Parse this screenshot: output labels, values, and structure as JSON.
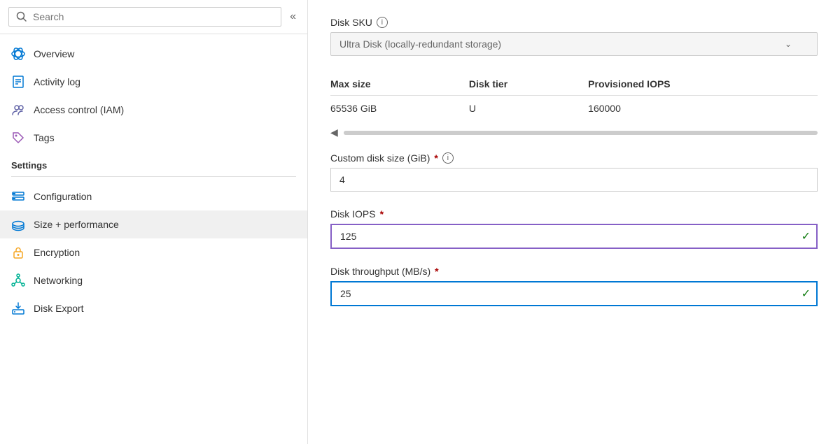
{
  "sidebar": {
    "search": {
      "placeholder": "Search",
      "value": ""
    },
    "collapse_label": "«",
    "nav_items": [
      {
        "id": "overview",
        "label": "Overview",
        "icon": "overview",
        "active": false
      },
      {
        "id": "activity-log",
        "label": "Activity log",
        "icon": "activity",
        "active": false
      },
      {
        "id": "access-control",
        "label": "Access control (IAM)",
        "icon": "access",
        "active": false
      },
      {
        "id": "tags",
        "label": "Tags",
        "icon": "tags",
        "active": false
      }
    ],
    "settings_section": {
      "label": "Settings",
      "items": [
        {
          "id": "configuration",
          "label": "Configuration",
          "icon": "config",
          "active": false
        },
        {
          "id": "size-performance",
          "label": "Size + performance",
          "icon": "size",
          "active": true
        },
        {
          "id": "encryption",
          "label": "Encryption",
          "icon": "encryption",
          "active": false
        },
        {
          "id": "networking",
          "label": "Networking",
          "icon": "networking",
          "active": false
        },
        {
          "id": "disk-export",
          "label": "Disk Export",
          "icon": "export",
          "active": false
        }
      ]
    }
  },
  "main": {
    "disk_sku": {
      "label": "Disk SKU",
      "value": "Ultra Disk (locally-redundant storage)"
    },
    "table": {
      "columns": [
        "Max size",
        "Disk tier",
        "Provisioned IOPS"
      ],
      "rows": [
        {
          "max_size": "65536 GiB",
          "disk_tier": "U",
          "provisioned_iops": "160000"
        }
      ]
    },
    "custom_disk_size": {
      "label": "Custom disk size (GiB)",
      "required": true,
      "value": "4"
    },
    "disk_iops": {
      "label": "Disk IOPS",
      "required": true,
      "value": "125"
    },
    "disk_throughput": {
      "label": "Disk throughput (MB/s)",
      "required": true,
      "value": "25"
    }
  }
}
